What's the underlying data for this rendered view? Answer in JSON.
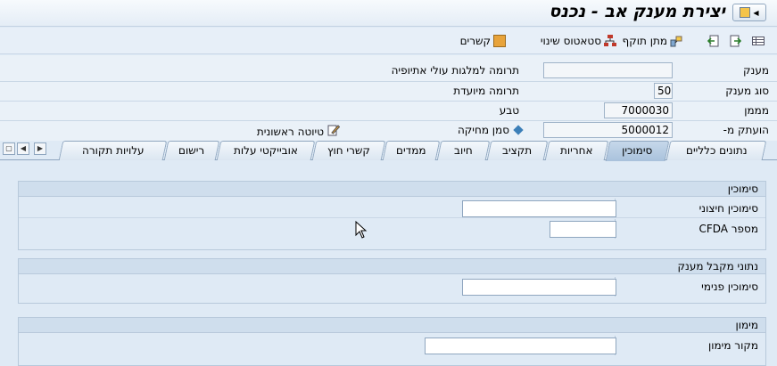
{
  "window": {
    "title": "יצירת מענק אב - נכנס"
  },
  "toolbar": {
    "relations_label": "קשרים",
    "status_change_label": "סטאטוס שינוי",
    "validity_label": "מתן תוקף"
  },
  "header": {
    "grantor_label": "מענק",
    "grantor_value": "",
    "grantor_desc": "תרומה למלגות עולי אתיופיה",
    "grant_type_label": "סוג מענק",
    "grant_type_value": "50",
    "grant_type_desc": "תרומה מיועדת",
    "sponsor_label": "מממן",
    "sponsor_value": "7000030",
    "currency_label": "טבע",
    "copied_from_label": "הועתק מ-",
    "copied_from_value": "5000012",
    "deletion_flag_label": "סמן מחיקה",
    "draft_label": "טיוטה ראשונית"
  },
  "tabs": [
    {
      "label": "נתונים כלליים",
      "active": false
    },
    {
      "label": "סימוכין",
      "active": true
    },
    {
      "label": "אחריות",
      "active": false
    },
    {
      "label": "תקציב",
      "active": false
    },
    {
      "label": "חיוב",
      "active": false
    },
    {
      "label": "ממדים",
      "active": false
    },
    {
      "label": "קשרי חוץ",
      "active": false
    },
    {
      "label": "אובייקטי עלות",
      "active": false
    },
    {
      "label": "רישום",
      "active": false
    },
    {
      "label": "עלויות תקורה",
      "active": false
    }
  ],
  "groups": {
    "reference": {
      "title": "סימוכין",
      "external_ref_label": "סימוכין חיצוני",
      "external_ref_value": "",
      "cfda_label": "מספר CFDA",
      "cfda_value": ""
    },
    "recipient": {
      "title": "נתוני מקבל מענק",
      "internal_ref_label": "סימוכין פנימי",
      "internal_ref_value": ""
    },
    "funding": {
      "title": "מימון",
      "funding_source_label": "מקור מימון",
      "funding_source_value": ""
    }
  },
  "colors": {
    "accent": "#a9c2dc",
    "background": "#dfeaf5",
    "diamond": "#3c7fb8"
  }
}
